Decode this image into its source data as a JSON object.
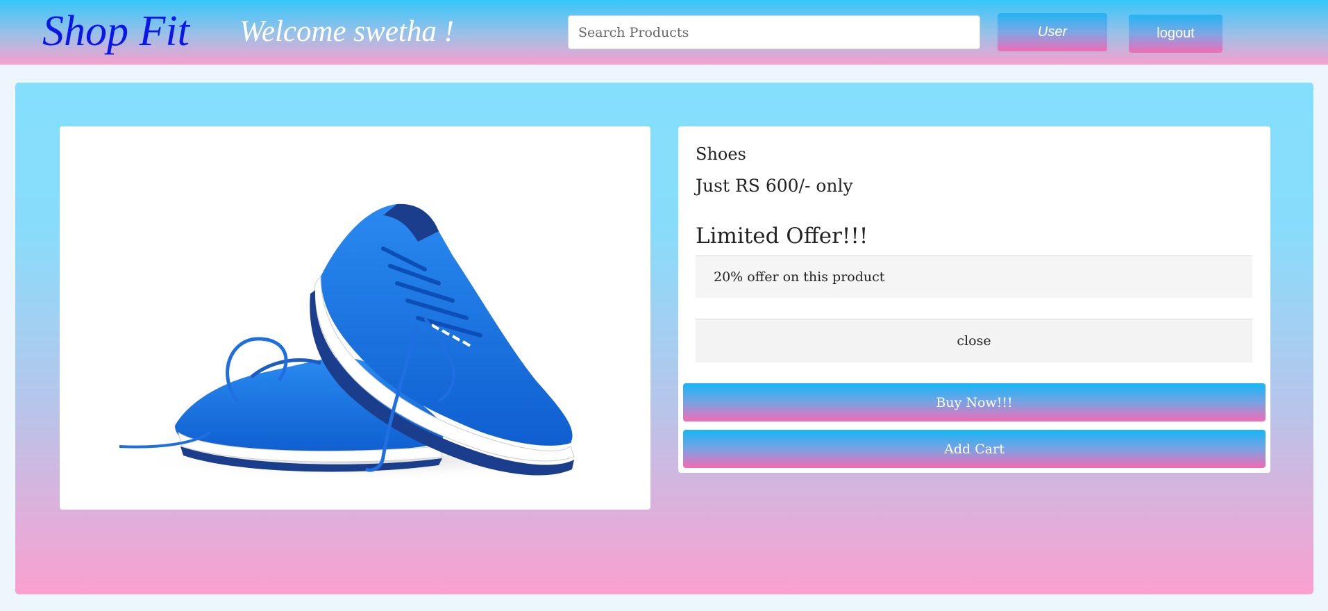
{
  "header": {
    "brand": "Shop Fit",
    "welcome": "Welcome swetha !",
    "search_placeholder": "Search Products",
    "user_label": "User",
    "logout_label": "logout"
  },
  "product": {
    "name": "Shoes",
    "price": "Just RS 600/- only",
    "offer_title": "Limited Offer!!!",
    "offer_text": "20% offer on this product",
    "close_label": "close",
    "buy_label": "Buy Now!!!",
    "cart_label": "Add Cart",
    "image": "blue-running-shoes"
  },
  "colors": {
    "brand": "#0b16e8",
    "header_top": "#36c6fb",
    "header_bottom": "#f7a0cd",
    "panel_top": "#84dffd",
    "panel_bottom": "#faa0cf",
    "button_top": "#15b6f6",
    "button_bottom": "#f36bb3",
    "shoe_blue": "#1a73e8"
  }
}
